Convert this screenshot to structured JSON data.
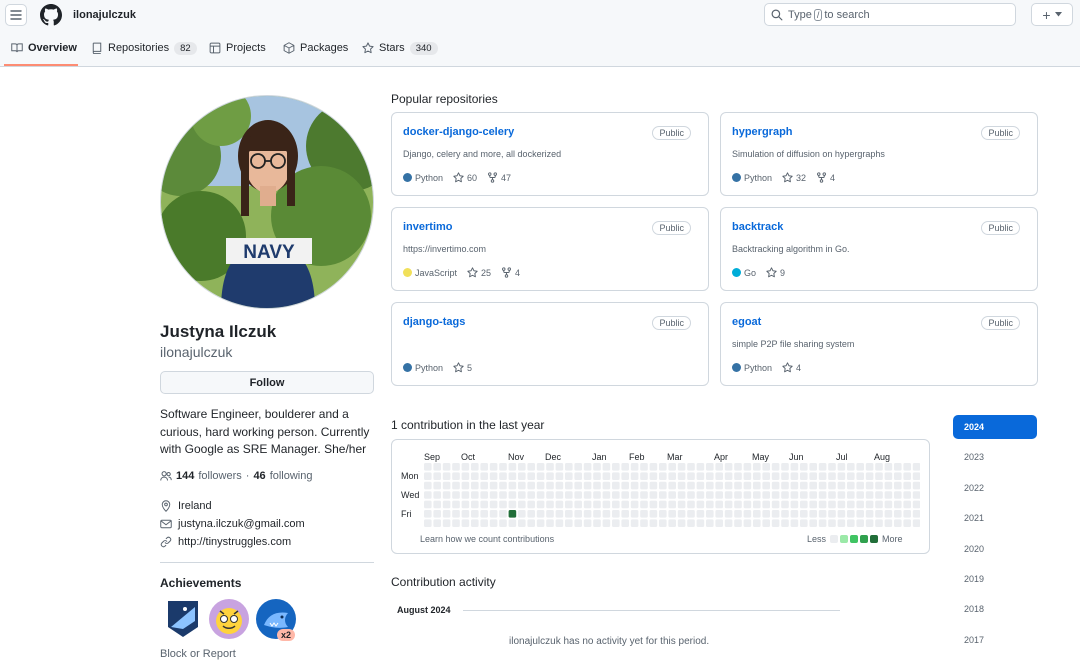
{
  "header": {
    "username": "ilonajulczuk",
    "search": {
      "prefix": "Type",
      "key": "/",
      "suffix": "to search"
    }
  },
  "tabs": [
    {
      "label": "Overview"
    },
    {
      "label": "Repositories",
      "count": "82"
    },
    {
      "label": "Projects"
    },
    {
      "label": "Packages"
    },
    {
      "label": "Stars",
      "count": "340"
    }
  ],
  "profile": {
    "full_name": "Justyna Ilczuk",
    "login": "ilonajulczuk",
    "follow_label": "Follow",
    "bio": "Software Engineer, boulderer and a curious, hard working person. Currently with Google as SRE Manager. She/her",
    "followers": "144",
    "followers_label": "followers",
    "following": "46",
    "following_label": "following",
    "location": "Ireland",
    "email": "justyna.ilczuk@gmail.com",
    "website": "http://tinystruggles.com",
    "shirt_text": "NAVY",
    "achievements_title": "Achievements",
    "achievement_multiplier": "x2",
    "block_label": "Block or Report"
  },
  "popular": {
    "title": "Popular repositories",
    "repos": [
      {
        "name": "docker-django-celery",
        "visibility": "Public",
        "description": "Django, celery and more, all dockerized",
        "language": "Python",
        "lang_color": "#3572A5",
        "stars": "60",
        "forks": "47"
      },
      {
        "name": "hypergraph",
        "visibility": "Public",
        "description": "Simulation of diffusion on hypergraphs",
        "language": "Python",
        "lang_color": "#3572A5",
        "stars": "32",
        "forks": "4"
      },
      {
        "name": "invertimo",
        "visibility": "Public",
        "description": "https://invertimo.com",
        "language": "JavaScript",
        "lang_color": "#f1e05a",
        "stars": "25",
        "forks": "4"
      },
      {
        "name": "backtrack",
        "visibility": "Public",
        "description": "Backtracking algorithm in Go.",
        "language": "Go",
        "lang_color": "#00ADD8",
        "stars": "9",
        "forks": ""
      },
      {
        "name": "django-tags",
        "visibility": "Public",
        "description": "",
        "language": "Python",
        "lang_color": "#3572A5",
        "stars": "5",
        "forks": ""
      },
      {
        "name": "egoat",
        "visibility": "Public",
        "description": "simple P2P file sharing system",
        "language": "Python",
        "lang_color": "#3572A5",
        "stars": "4",
        "forks": ""
      }
    ]
  },
  "contributions": {
    "title": "1 contribution in the last year",
    "months": [
      "Sep",
      "Oct",
      "Nov",
      "Dec",
      "Jan",
      "Feb",
      "Mar",
      "Apr",
      "May",
      "Jun",
      "Jul",
      "Aug"
    ],
    "days": [
      "Mon",
      "Wed",
      "Fri"
    ],
    "learn_label": "Learn how we count contributions",
    "legend_less": "Less",
    "legend_more": "More",
    "legend_colors": [
      "#ebedf0",
      "#9be9a8",
      "#40c463",
      "#30a14e",
      "#216e39"
    ],
    "empty_color": "#ebedf0",
    "active_cell": {
      "week": 9,
      "day": 5,
      "color": "#216e39"
    }
  },
  "years": [
    "2024",
    "2023",
    "2022",
    "2021",
    "2020",
    "2019",
    "2018",
    "2017"
  ],
  "activity": {
    "title": "Contribution activity",
    "month": "August 2024",
    "empty_message": "ilonajulczuk has no activity yet for this period."
  }
}
